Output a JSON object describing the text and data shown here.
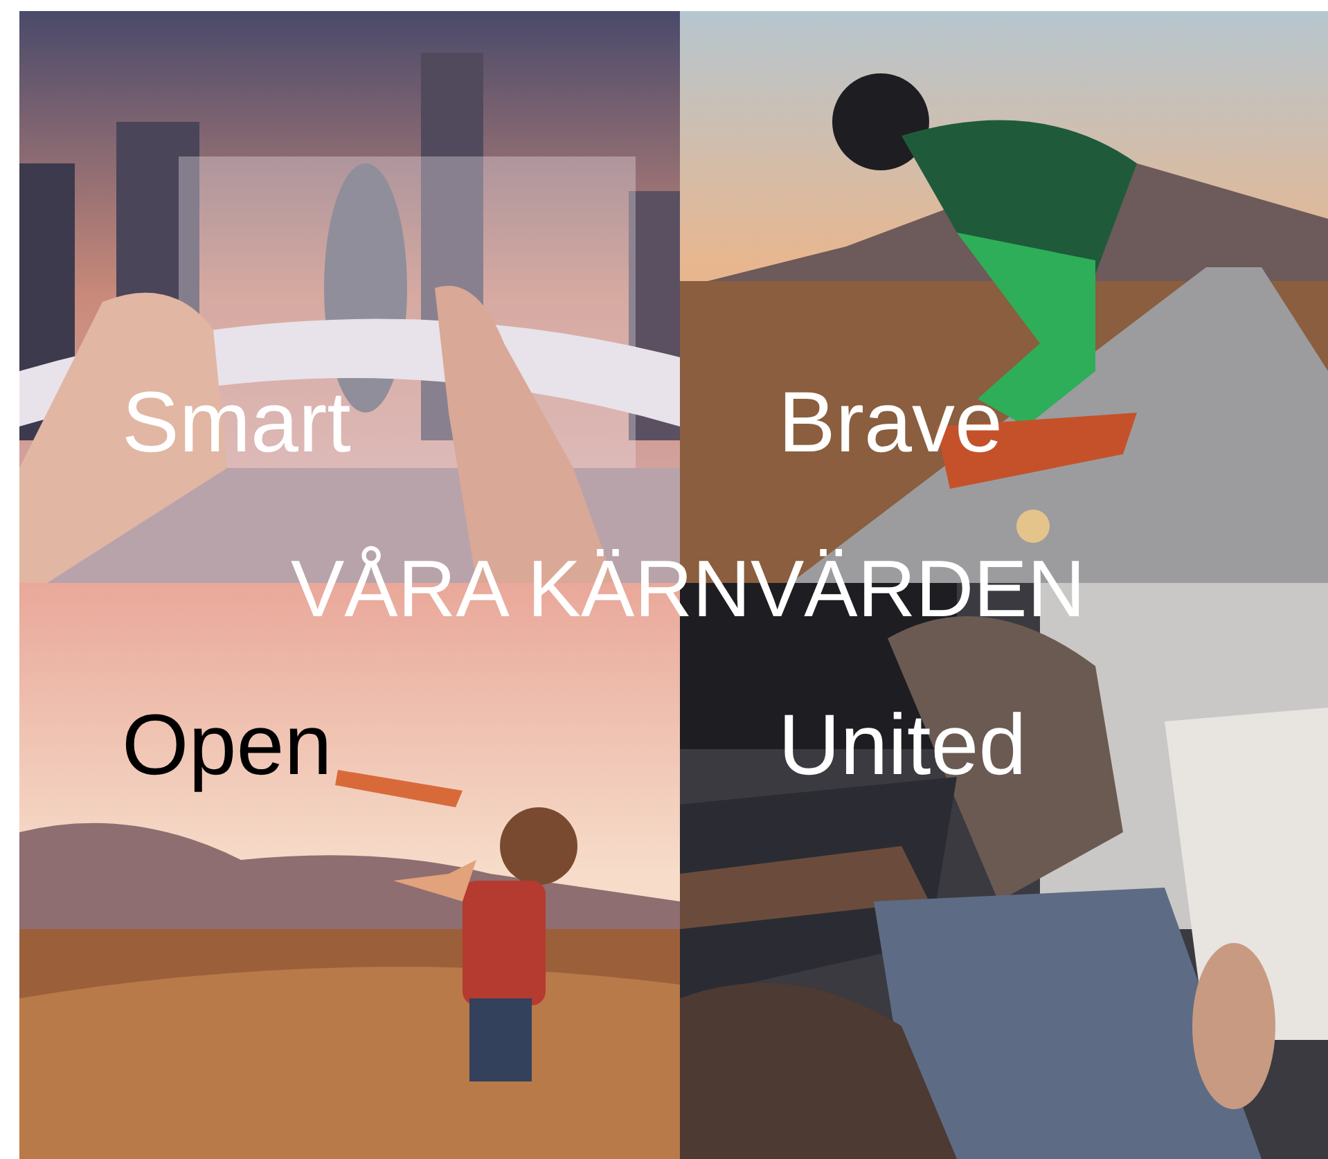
{
  "title": "VÅRA KÄRNVÄRDEN",
  "tiles": [
    {
      "label": "Smart",
      "dark_text": false
    },
    {
      "label": "Brave",
      "dark_text": false
    },
    {
      "label": "Open",
      "dark_text": true
    },
    {
      "label": "United",
      "dark_text": false
    }
  ]
}
